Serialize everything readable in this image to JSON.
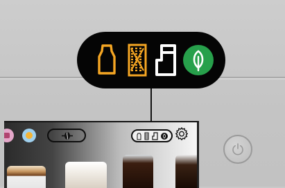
{
  "app": {
    "name": "",
    "window_title": ""
  },
  "status_panel": {
    "icons": [
      {
        "icon": "milk-carton-icon",
        "color": "#f5a623",
        "state": "warning"
      },
      {
        "icon": "filter-cartridge-icon",
        "color": "#f5a623",
        "state": "warning"
      },
      {
        "icon": "water-tank-icon",
        "color": "#ffffff",
        "state": "normal"
      },
      {
        "icon": "eco-leaf-icon",
        "color": "#27a04b",
        "state": "active"
      }
    ]
  },
  "display": {
    "top_bar": {
      "favorites": [
        {
          "icon": "pink-beverage-icon",
          "color": "#e4a7c9"
        },
        {
          "icon": "sun-beverage-icon",
          "color": "#9fd0ee"
        }
      ],
      "bean_selector": {
        "icon": "coffee-bean-icon"
      },
      "mini_status": {
        "icons": [
          "milk-carton-icon",
          "filter-cartridge-icon",
          "water-tank-icon",
          "eco-leaf-icon"
        ]
      },
      "settings": {
        "icon": "gear-icon"
      }
    },
    "drinks": [
      {
        "name": "",
        "icon": "espresso-cup"
      },
      {
        "name": "",
        "icon": "cappuccino-cup"
      },
      {
        "name": "",
        "icon": "iced-coffee-glass"
      },
      {
        "name": "",
        "icon": "coffee-glass"
      }
    ]
  },
  "power": {
    "icon": "power-icon"
  },
  "colors": {
    "panel_background": "#050505",
    "warning": "#f5a623",
    "eco": "#27a04b",
    "body": "#c9c9c9"
  }
}
